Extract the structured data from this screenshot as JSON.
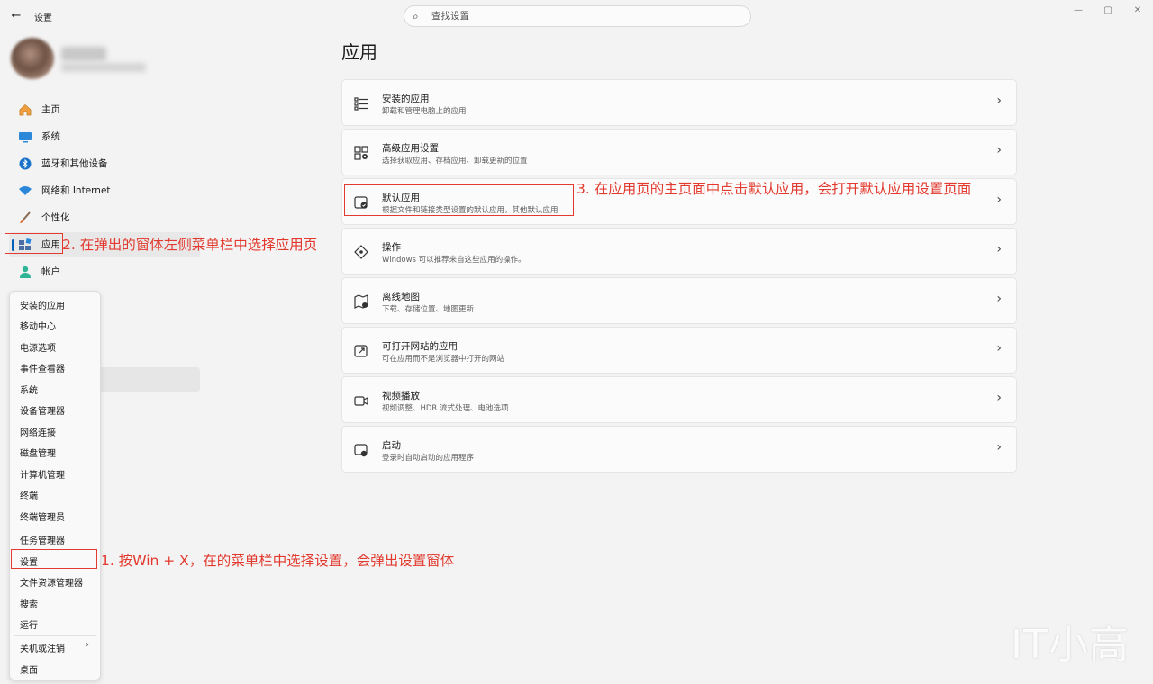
{
  "titlebar": {
    "back_label": "←",
    "title": "设置",
    "search_placeholder": "查找设置",
    "minimize": "—",
    "maximize": "▢",
    "close": "✕"
  },
  "sidebar": {
    "items": [
      {
        "label": "主页",
        "icon": "home-icon"
      },
      {
        "label": "系统",
        "icon": "monitor-icon"
      },
      {
        "label": "蓝牙和其他设备",
        "icon": "bluetooth-icon"
      },
      {
        "label": "网络和 Internet",
        "icon": "wifi-icon"
      },
      {
        "label": "个性化",
        "icon": "brush-icon"
      },
      {
        "label": "应用",
        "icon": "apps-icon"
      },
      {
        "label": "帐户",
        "icon": "person-icon"
      }
    ],
    "active_index": 5
  },
  "main": {
    "title": "应用",
    "cards": [
      {
        "title": "安装的应用",
        "desc": "卸载和管理电脑上的应用"
      },
      {
        "title": "高级应用设置",
        "desc": "选择获取应用、存档应用、卸载更新的位置"
      },
      {
        "title": "默认应用",
        "desc": "根据文件和链接类型设置的默认应用，其他默认应用"
      },
      {
        "title": "操作",
        "desc": "Windows 可以推荐来自这些应用的操作。"
      },
      {
        "title": "离线地图",
        "desc": "下载、存储位置、地图更新"
      },
      {
        "title": "可打开网站的应用",
        "desc": "可在应用而不是浏览器中打开的网站"
      },
      {
        "title": "视频播放",
        "desc": "视频调整、HDR 流式处理、电池选项"
      },
      {
        "title": "启动",
        "desc": "登录时自动启动的应用程序"
      }
    ]
  },
  "context_menu": {
    "items": [
      "安装的应用",
      "移动中心",
      "电源选项",
      "事件查看器",
      "系统",
      "设备管理器",
      "网络连接",
      "磁盘管理",
      "计算机管理",
      "终端",
      "终端管理员",
      "任务管理器",
      "设置",
      "文件资源管理器",
      "搜索",
      "运行",
      "关机或注销",
      "桌面"
    ]
  },
  "annotations": {
    "step1": "1. 按Win + X，在的菜单栏中选择设置，会弹出设置窗体",
    "step2": "2. 在弹出的窗体左侧菜单栏中选择应用页",
    "step3": "3. 在应用页的主页面中点击默认应用，会打开默认应用设置页面"
  },
  "watermark": "IT小高",
  "colors": {
    "accent": "#005fb8",
    "annotation": "#e23a2e"
  }
}
